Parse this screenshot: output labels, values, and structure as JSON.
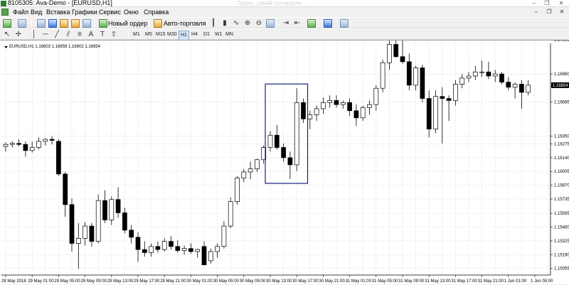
{
  "window": {
    "title": "8105305: Ava-Demo - [EURUSD,H1]",
    "ghost_text": "Ладно, давай поговорим…",
    "controls": {
      "minimize": "–",
      "restore": "❐",
      "close": "✕"
    }
  },
  "menu": {
    "items": [
      "Файл",
      "Вид",
      "Вставка",
      "Графики",
      "Сервис",
      "Окно",
      "Справка"
    ],
    "mdi_controls": {
      "minimize": "–",
      "restore": "❐",
      "close": "✕"
    }
  },
  "toolbar1": {
    "new_order_label": "Новый ордер",
    "auto_trading_label": "Авто-торговля"
  },
  "toolbar2": {
    "timeframes": [
      "M1",
      "M5",
      "M15",
      "M30",
      "H1",
      "H4",
      "D1",
      "W1",
      "MN"
    ],
    "active_timeframe": "H1"
  },
  "chart": {
    "header": "EURUSD,H1  1.16803 1.16859 1.16802 1.16854",
    "bid_label": "1.16854",
    "colors": {
      "grid": "#c0c0c0",
      "candle_bull": "#ffffff",
      "candle_bear": "#000000",
      "highlight_box": "#1a237e",
      "bid_box": "#000000"
    },
    "highlight": {
      "from_index": 40,
      "to_index": 45
    }
  },
  "chart_data": {
    "type": "candlestick",
    "symbol": "EURUSD",
    "timeframe": "H1",
    "ylim": [
      1.1499,
      1.1726
    ],
    "y_ticks": [
      1.17295,
      1.1696,
      1.16685,
      1.1635,
      1.16275,
      1.1614,
      1.16005,
      1.1587,
      1.15735,
      1.15595,
      1.1546,
      1.15325,
      1.1519,
      1.15055
    ],
    "y_tick_labels": [
      "1.17295",
      "1.16960",
      "1.16685",
      "1.16350",
      "1.16275",
      "1.16140",
      "1.16005",
      "1.15870",
      "1.15735",
      "1.15595",
      "1.15460",
      "1.15325",
      "1.15190",
      "1.15055"
    ],
    "x_labels": [
      {
        "i": 0,
        "text": "28 May 2018"
      },
      {
        "i": 4,
        "text": "29 May 01:00"
      },
      {
        "i": 8,
        "text": "29 May 05:00"
      },
      {
        "i": 12,
        "text": "29 May 09:00"
      },
      {
        "i": 16,
        "text": "29 May 13:00"
      },
      {
        "i": 20,
        "text": "29 May 17:00"
      },
      {
        "i": 24,
        "text": "29 May 21:00"
      },
      {
        "i": 28,
        "text": "30 May 01:00"
      },
      {
        "i": 32,
        "text": "30 May 05:00"
      },
      {
        "i": 36,
        "text": "30 May 09:00"
      },
      {
        "i": 40,
        "text": "30 May 13:00"
      },
      {
        "i": 44,
        "text": "30 May 17:00"
      },
      {
        "i": 48,
        "text": "30 May 21:00"
      },
      {
        "i": 52,
        "text": "31 May 01:00"
      },
      {
        "i": 56,
        "text": "31 May 05:00"
      },
      {
        "i": 60,
        "text": "31 May 09:00"
      },
      {
        "i": 64,
        "text": "31 May 13:00"
      },
      {
        "i": 68,
        "text": "31 May 17:00"
      },
      {
        "i": 72,
        "text": "31 May 21:00"
      },
      {
        "i": 76,
        "text": "1 Jun 01:00"
      },
      {
        "i": 80,
        "text": "1 Jun 05:00"
      }
    ],
    "candles": [
      {
        "o": 1.1625,
        "h": 1.1629,
        "l": 1.162,
        "c": 1.1627
      },
      {
        "o": 1.1627,
        "h": 1.163,
        "l": 1.1624,
        "c": 1.1628
      },
      {
        "o": 1.1628,
        "h": 1.1632,
        "l": 1.1625,
        "c": 1.1627
      },
      {
        "o": 1.1627,
        "h": 1.163,
        "l": 1.1615,
        "c": 1.1621
      },
      {
        "o": 1.1621,
        "h": 1.163,
        "l": 1.1619,
        "c": 1.1624
      },
      {
        "o": 1.1624,
        "h": 1.1634,
        "l": 1.1622,
        "c": 1.163
      },
      {
        "o": 1.163,
        "h": 1.1633,
        "l": 1.1626,
        "c": 1.1632
      },
      {
        "o": 1.1632,
        "h": 1.1635,
        "l": 1.1627,
        "c": 1.1631
      },
      {
        "o": 1.163,
        "h": 1.1632,
        "l": 1.1596,
        "c": 1.1598
      },
      {
        "o": 1.1598,
        "h": 1.16,
        "l": 1.1556,
        "c": 1.1568
      },
      {
        "o": 1.1568,
        "h": 1.1574,
        "l": 1.1522,
        "c": 1.153
      },
      {
        "o": 1.153,
        "h": 1.155,
        "l": 1.1505,
        "c": 1.1535
      },
      {
        "o": 1.1535,
        "h": 1.1551,
        "l": 1.1528,
        "c": 1.1547
      },
      {
        "o": 1.1547,
        "h": 1.155,
        "l": 1.1527,
        "c": 1.1532
      },
      {
        "o": 1.1532,
        "h": 1.1578,
        "l": 1.153,
        "c": 1.1572
      },
      {
        "o": 1.1572,
        "h": 1.1582,
        "l": 1.155,
        "c": 1.1553
      },
      {
        "o": 1.1553,
        "h": 1.1576,
        "l": 1.1548,
        "c": 1.1573
      },
      {
        "o": 1.1573,
        "h": 1.1585,
        "l": 1.1555,
        "c": 1.156
      },
      {
        "o": 1.156,
        "h": 1.1565,
        "l": 1.154,
        "c": 1.1543
      },
      {
        "o": 1.1543,
        "h": 1.1548,
        "l": 1.153,
        "c": 1.1536
      },
      {
        "o": 1.1536,
        "h": 1.1541,
        "l": 1.1512,
        "c": 1.1524
      },
      {
        "o": 1.1524,
        "h": 1.1532,
        "l": 1.1517,
        "c": 1.1521
      },
      {
        "o": 1.1521,
        "h": 1.153,
        "l": 1.1517,
        "c": 1.1527
      },
      {
        "o": 1.1527,
        "h": 1.1532,
        "l": 1.1521,
        "c": 1.1524
      },
      {
        "o": 1.1524,
        "h": 1.1535,
        "l": 1.1522,
        "c": 1.1532
      },
      {
        "o": 1.1532,
        "h": 1.1537,
        "l": 1.1524,
        "c": 1.1527
      },
      {
        "o": 1.1527,
        "h": 1.1533,
        "l": 1.1521,
        "c": 1.1523
      },
      {
        "o": 1.1523,
        "h": 1.1528,
        "l": 1.1519,
        "c": 1.1525
      },
      {
        "o": 1.1525,
        "h": 1.153,
        "l": 1.152,
        "c": 1.1522
      },
      {
        "o": 1.1522,
        "h": 1.1525,
        "l": 1.1516,
        "c": 1.1524
      },
      {
        "o": 1.1527,
        "h": 1.1532,
        "l": 1.1519,
        "c": 1.1509
      },
      {
        "o": 1.1513,
        "h": 1.1525,
        "l": 1.151,
        "c": 1.1522
      },
      {
        "o": 1.1522,
        "h": 1.153,
        "l": 1.1516,
        "c": 1.1527
      },
      {
        "o": 1.1527,
        "h": 1.1552,
        "l": 1.1525,
        "c": 1.1547
      },
      {
        "o": 1.1547,
        "h": 1.1575,
        "l": 1.1545,
        "c": 1.1571
      },
      {
        "o": 1.1571,
        "h": 1.1596,
        "l": 1.1568,
        "c": 1.1594
      },
      {
        "o": 1.1594,
        "h": 1.1603,
        "l": 1.159,
        "c": 1.16
      },
      {
        "o": 1.16,
        "h": 1.161,
        "l": 1.1593,
        "c": 1.1603
      },
      {
        "o": 1.1603,
        "h": 1.1613,
        "l": 1.16,
        "c": 1.1612
      },
      {
        "o": 1.1612,
        "h": 1.1626,
        "l": 1.1608,
        "c": 1.1624
      },
      {
        "o": 1.1624,
        "h": 1.164,
        "l": 1.162,
        "c": 1.1636
      },
      {
        "o": 1.1636,
        "h": 1.1646,
        "l": 1.1622,
        "c": 1.1624
      },
      {
        "o": 1.1624,
        "h": 1.1628,
        "l": 1.161,
        "c": 1.1614
      },
      {
        "o": 1.1614,
        "h": 1.162,
        "l": 1.1593,
        "c": 1.1607
      },
      {
        "o": 1.1607,
        "h": 1.1682,
        "l": 1.1601,
        "c": 1.1668
      },
      {
        "o": 1.1668,
        "h": 1.1672,
        "l": 1.1648,
        "c": 1.1652
      },
      {
        "o": 1.1652,
        "h": 1.166,
        "l": 1.1642,
        "c": 1.1656
      },
      {
        "o": 1.1656,
        "h": 1.1665,
        "l": 1.165,
        "c": 1.1662
      },
      {
        "o": 1.1662,
        "h": 1.1673,
        "l": 1.1657,
        "c": 1.1668
      },
      {
        "o": 1.1668,
        "h": 1.1675,
        "l": 1.1663,
        "c": 1.167
      },
      {
        "o": 1.167,
        "h": 1.1675,
        "l": 1.1663,
        "c": 1.1666
      },
      {
        "o": 1.1666,
        "h": 1.167,
        "l": 1.1662,
        "c": 1.1668
      },
      {
        "o": 1.1668,
        "h": 1.1672,
        "l": 1.1655,
        "c": 1.166
      },
      {
        "o": 1.166,
        "h": 1.1666,
        "l": 1.1645,
        "c": 1.1653
      },
      {
        "o": 1.1653,
        "h": 1.1665,
        "l": 1.165,
        "c": 1.1663
      },
      {
        "o": 1.1663,
        "h": 1.167,
        "l": 1.1656,
        "c": 1.1666
      },
      {
        "o": 1.1666,
        "h": 1.1685,
        "l": 1.166,
        "c": 1.1682
      },
      {
        "o": 1.1682,
        "h": 1.171,
        "l": 1.1678,
        "c": 1.1707
      },
      {
        "o": 1.1707,
        "h": 1.173,
        "l": 1.17,
        "c": 1.1725
      },
      {
        "o": 1.1725,
        "h": 1.1732,
        "l": 1.1712,
        "c": 1.1713
      },
      {
        "o": 1.1713,
        "h": 1.1732,
        "l": 1.1706,
        "c": 1.1708
      },
      {
        "o": 1.1708,
        "h": 1.1716,
        "l": 1.168,
        "c": 1.1685
      },
      {
        "o": 1.1685,
        "h": 1.1704,
        "l": 1.168,
        "c": 1.1702
      },
      {
        "o": 1.1702,
        "h": 1.1705,
        "l": 1.1668,
        "c": 1.1672
      },
      {
        "o": 1.1672,
        "h": 1.168,
        "l": 1.1634,
        "c": 1.1642
      },
      {
        "o": 1.1642,
        "h": 1.168,
        "l": 1.1638,
        "c": 1.1674
      },
      {
        "o": 1.1674,
        "h": 1.1683,
        "l": 1.1628,
        "c": 1.1672
      },
      {
        "o": 1.1672,
        "h": 1.1675,
        "l": 1.165,
        "c": 1.167
      },
      {
        "o": 1.167,
        "h": 1.169,
        "l": 1.1665,
        "c": 1.1686
      },
      {
        "o": 1.1686,
        "h": 1.1696,
        "l": 1.1682,
        "c": 1.1692
      },
      {
        "o": 1.1692,
        "h": 1.1698,
        "l": 1.1688,
        "c": 1.1694
      },
      {
        "o": 1.1694,
        "h": 1.1704,
        "l": 1.169,
        "c": 1.1698
      },
      {
        "o": 1.1698,
        "h": 1.1709,
        "l": 1.1693,
        "c": 1.1698
      },
      {
        "o": 1.1698,
        "h": 1.1708,
        "l": 1.1691,
        "c": 1.1694
      },
      {
        "o": 1.1694,
        "h": 1.17,
        "l": 1.1688,
        "c": 1.1696
      },
      {
        "o": 1.1696,
        "h": 1.1698,
        "l": 1.1686,
        "c": 1.1688
      },
      {
        "o": 1.1688,
        "h": 1.1693,
        "l": 1.168,
        "c": 1.1683
      },
      {
        "o": 1.1683,
        "h": 1.1688,
        "l": 1.1672,
        "c": 1.1686
      },
      {
        "o": 1.1686,
        "h": 1.169,
        "l": 1.1662,
        "c": 1.1678
      },
      {
        "o": 1.1678,
        "h": 1.169,
        "l": 1.1675,
        "c": 1.1685
      }
    ]
  }
}
